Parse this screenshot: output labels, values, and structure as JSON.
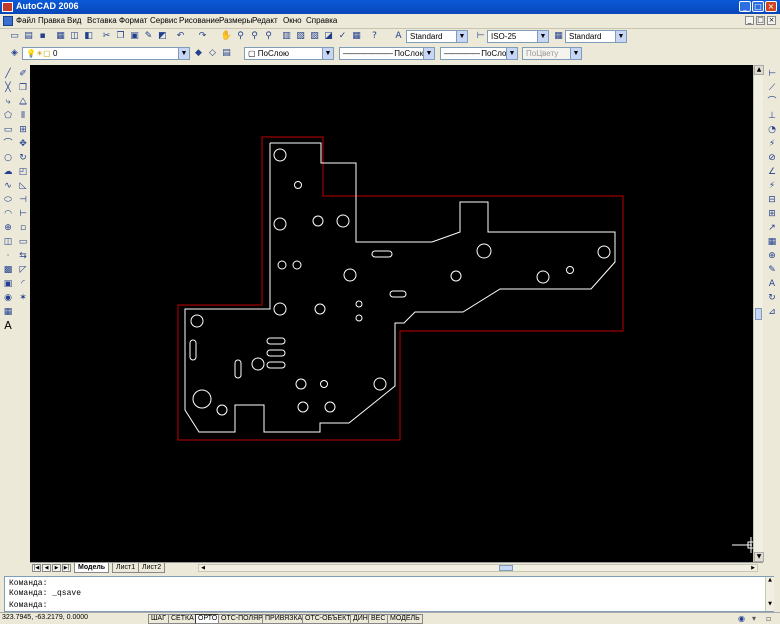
{
  "window": {
    "title": "AutoCAD 2006"
  },
  "menu": [
    "Файл",
    "Правка",
    "Вид",
    "Вставка",
    "Формат",
    "Сервис",
    "Рисование",
    "Размеры",
    "Редакт",
    "Окно",
    "Справка"
  ],
  "toolbars": {
    "text_style": "Standard",
    "dim_style": "ISO-25",
    "table_style": "Standard",
    "layer": "0",
    "color": "ПоСлою",
    "linetype": "ПоСлою",
    "lineweight": "ПоСлою",
    "plotstyle": "ПоЦвету"
  },
  "tabs": [
    "Модель",
    "Лист1",
    "Лист2"
  ],
  "active_tab": "Модель",
  "command_lines": [
    "Команда:",
    "Команда:  _qsave",
    "Команда:"
  ],
  "coords": "323.7945, -63.2179, 0.0000",
  "status_buttons": [
    {
      "label": "ШАГ",
      "on": false
    },
    {
      "label": "СЕТКА",
      "on": false
    },
    {
      "label": "ОРТО",
      "on": true
    },
    {
      "label": "ОТС-ПОЛЯР",
      "on": false
    },
    {
      "label": "ПРИВЯЗКА",
      "on": false
    },
    {
      "label": "ОТС-ОБЪЕКТ",
      "on": false
    },
    {
      "label": "ДИН",
      "on": false
    },
    {
      "label": "ВЕС",
      "on": false
    },
    {
      "label": "МОДЕЛЬ",
      "on": false
    }
  ],
  "colors": {
    "drawing_bg": "#000000",
    "part_outline": "#ffffff",
    "boundary": "#c00000",
    "titlebar": "#0a5ad8"
  }
}
